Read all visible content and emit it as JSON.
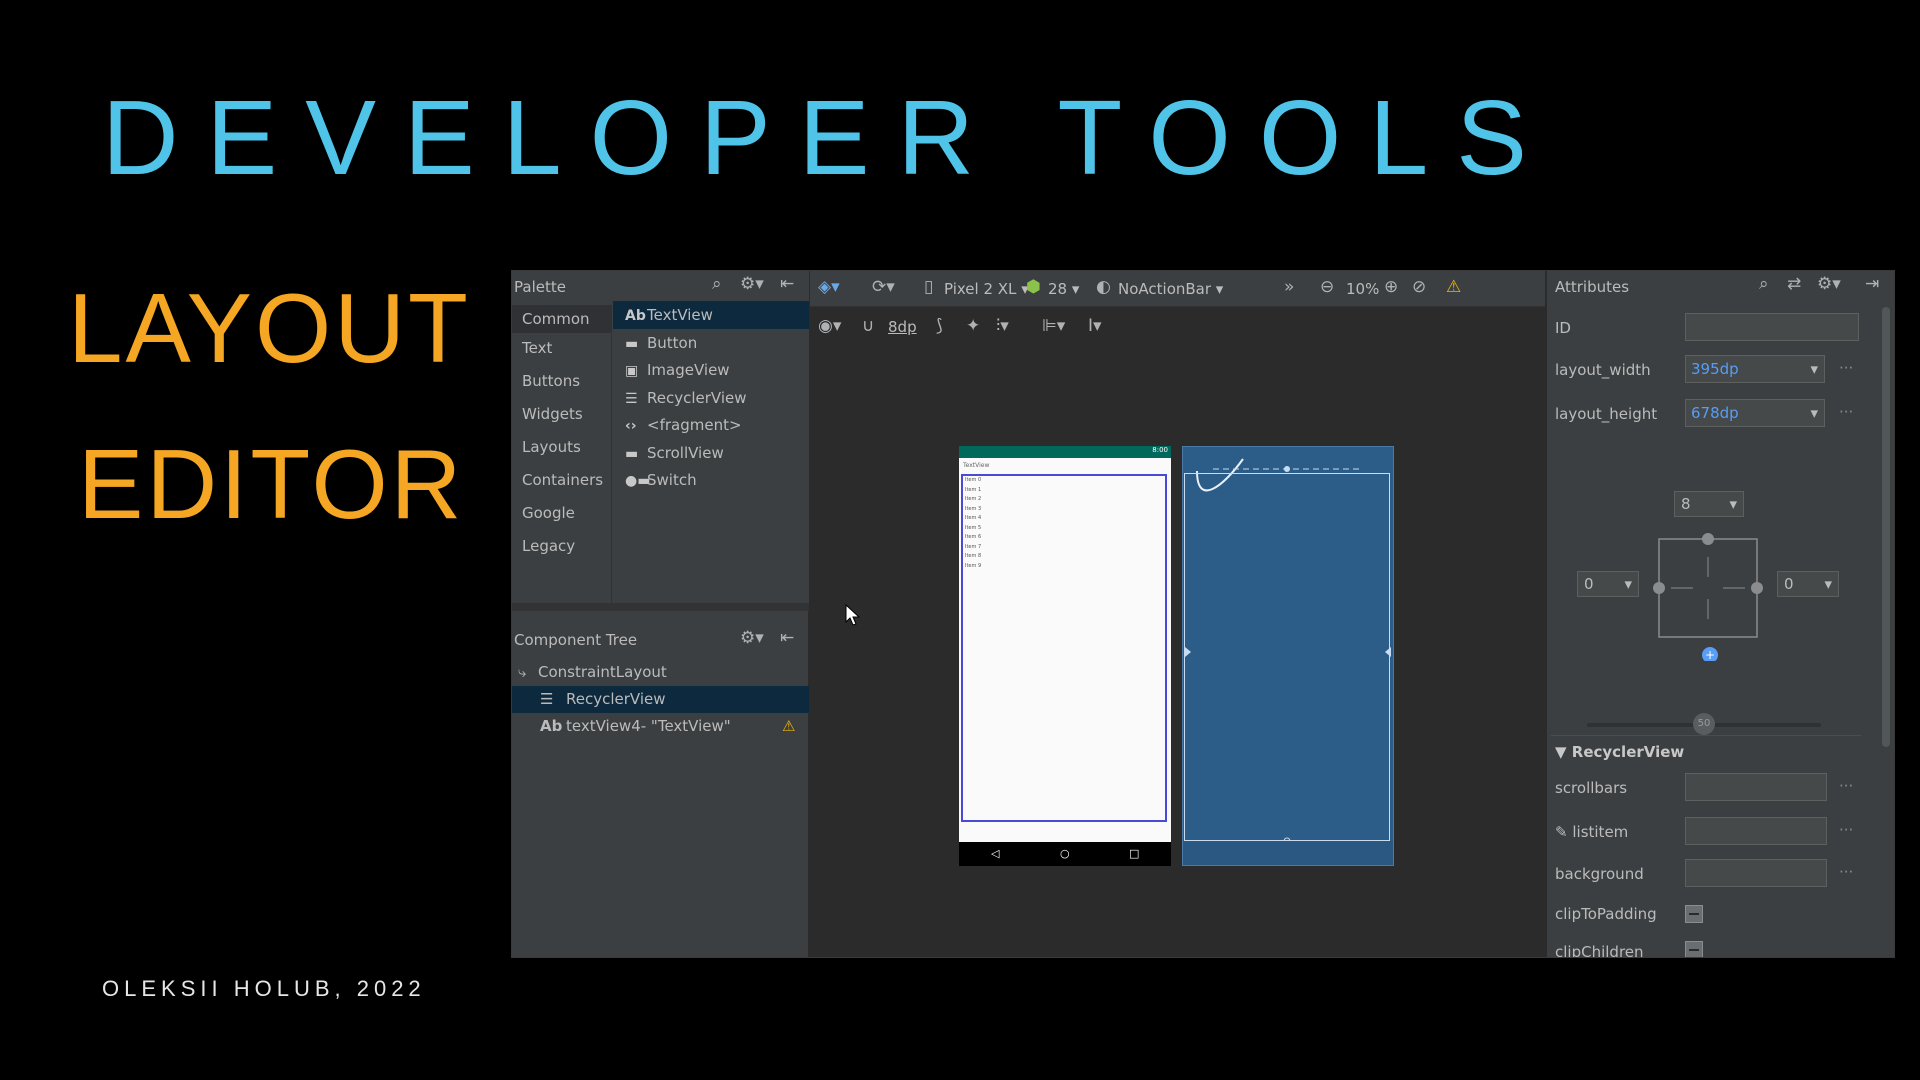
{
  "slide": {
    "title": "DEVELOPER TOOLS",
    "subtitle_line1": "LAYOUT",
    "subtitle_line2": "EDITOR",
    "author": "OLEKSII HOLUB, 2022"
  },
  "palette": {
    "title": "Palette",
    "categories": [
      "Common",
      "Text",
      "Buttons",
      "Widgets",
      "Layouts",
      "Containers",
      "Google",
      "Legacy"
    ],
    "items": [
      {
        "glyph": "Ab",
        "label": "TextView",
        "icon": "textview-icon"
      },
      {
        "glyph": "▬",
        "label": "Button",
        "icon": "button-icon"
      },
      {
        "glyph": "▣",
        "label": "ImageView",
        "icon": "imageview-icon"
      },
      {
        "glyph": "☰",
        "label": "RecyclerView",
        "icon": "recyclerview-icon"
      },
      {
        "glyph": "‹›",
        "label": "<fragment>",
        "icon": "fragment-icon"
      },
      {
        "glyph": "▬",
        "label": "ScrollView",
        "icon": "scrollview-icon"
      },
      {
        "glyph": "●▬",
        "label": "Switch",
        "icon": "switch-icon"
      }
    ]
  },
  "component_tree": {
    "title": "Component Tree",
    "rows": [
      {
        "glyph": "⤷",
        "label": "ConstraintLayout"
      },
      {
        "glyph": "☰",
        "label": "RecyclerView"
      },
      {
        "glyph": "Ab",
        "label": "textView4- \"TextView\""
      }
    ]
  },
  "toolbar": {
    "device": "Pixel 2 XL",
    "api": "28",
    "theme": "NoActionBar",
    "zoom": "10%",
    "margin": "8dp"
  },
  "preview": {
    "status_time": "8:00",
    "textview_text": "TextView",
    "items": [
      "Item 0",
      "Item 1",
      "Item 2",
      "Item 3",
      "Item 4",
      "Item 5",
      "Item 6",
      "Item 7",
      "Item 8",
      "Item 9"
    ]
  },
  "attributes": {
    "title": "Attributes",
    "id_label": "ID",
    "width_label": "layout_width",
    "width_value": "395dp",
    "height_label": "layout_height",
    "height_value": "678dp",
    "margin_top": "8",
    "margin_left": "0",
    "margin_right": "0",
    "bias": "50",
    "section": "RecyclerView",
    "scrollbars_label": "scrollbars",
    "listitem_label": "listitem",
    "background_label": "background",
    "cliptopadding_label": "clipToPadding",
    "clipchildren_label": "clipChildren",
    "more": "···"
  },
  "colors": {
    "title": "#4fc3e8",
    "subtitle": "#f5a623",
    "selection": "#0d293e",
    "link_value": "#589df6",
    "blueprint": "#2c5d89",
    "warning": "#f0b400"
  }
}
